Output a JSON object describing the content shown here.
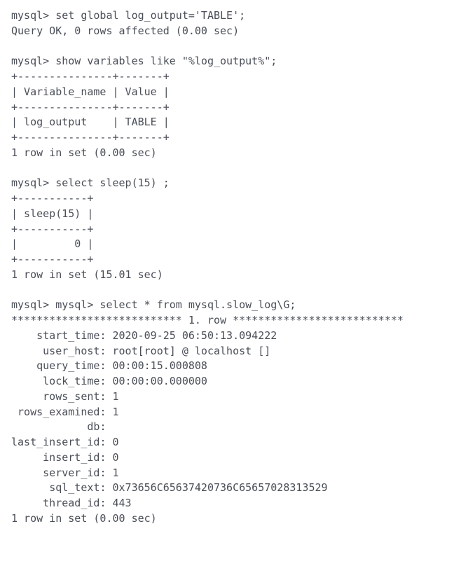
{
  "session": {
    "prompt": "mysql>",
    "commands": [
      {
        "cmd": "set global log_output='TABLE';",
        "result_lines": [
          "Query OK, 0 rows affected (0.00 sec)"
        ]
      },
      {
        "cmd": "show variables like \"%log_output%\";",
        "table": {
          "border_top": "+---------------+-------+",
          "header": "| Variable_name | Value |",
          "border_mid": "+---------------+-------+",
          "rows": [
            "| log_output    | TABLE |"
          ],
          "border_bot": "+---------------+-------+"
        },
        "footer": "1 row in set (0.00 sec)"
      },
      {
        "cmd": "select sleep(15) ;",
        "table": {
          "border_top": "+-----------+",
          "header": "| sleep(15) |",
          "border_mid": "+-----------+",
          "rows": [
            "|         0 |"
          ],
          "border_bot": "+-----------+"
        },
        "footer": "1 row in set (15.01 sec)"
      },
      {
        "cmd": "mysql> select * from mysql.slow_log\\G;",
        "row_header": "*************************** 1. row ***************************",
        "fields": [
          {
            "label": "start_time",
            "value": "2020-09-25 06:50:13.094222"
          },
          {
            "label": "user_host",
            "value": "root[root] @ localhost []"
          },
          {
            "label": "query_time",
            "value": "00:00:15.000808"
          },
          {
            "label": "lock_time",
            "value": "00:00:00.000000"
          },
          {
            "label": "rows_sent",
            "value": "1"
          },
          {
            "label": "rows_examined",
            "value": "1"
          },
          {
            "label": "db",
            "value": ""
          },
          {
            "label": "last_insert_id",
            "value": "0"
          },
          {
            "label": "insert_id",
            "value": "0"
          },
          {
            "label": "server_id",
            "value": "1"
          },
          {
            "label": "sql_text",
            "value": "0x73656C65637420736C65657028313529"
          },
          {
            "label": "thread_id",
            "value": "443"
          }
        ],
        "footer": "1 row in set (0.00 sec)"
      }
    ]
  }
}
